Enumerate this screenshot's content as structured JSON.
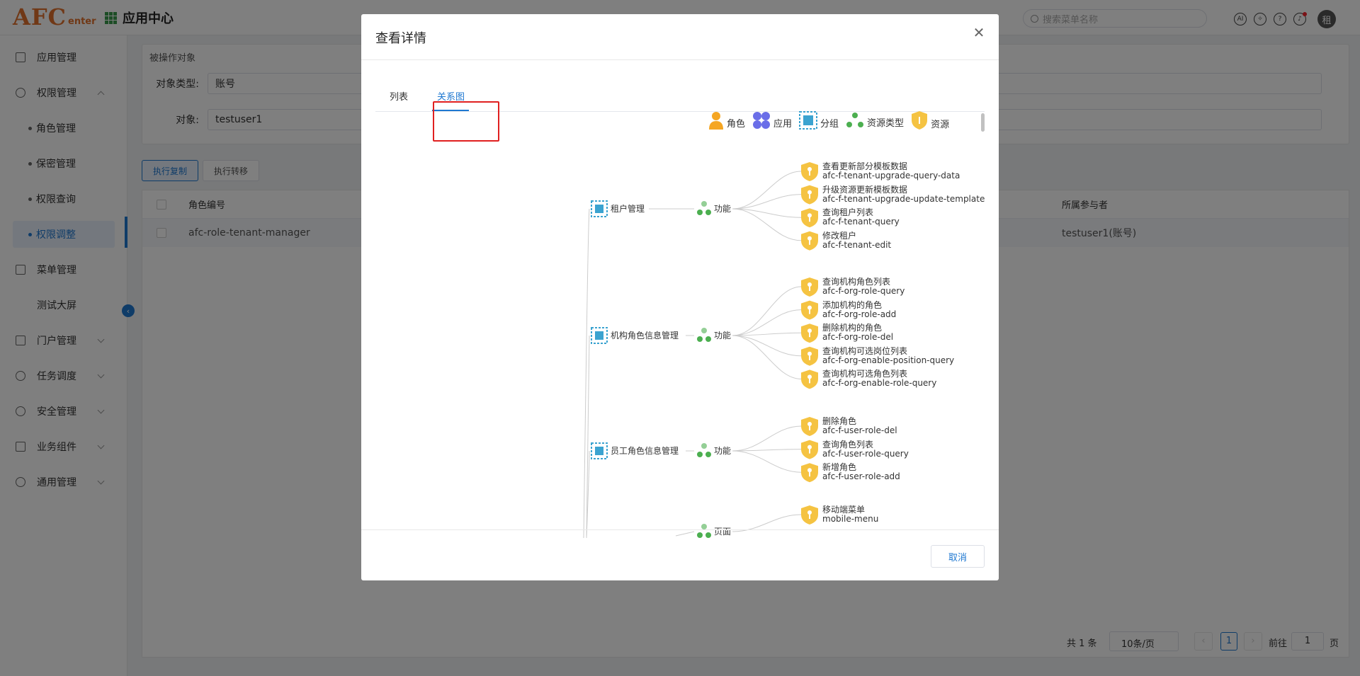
{
  "topbar": {
    "logo_main": "AFC",
    "logo_sub": "enter",
    "app_title": "应用中心",
    "search_placeholder": "搜索菜单名称",
    "ai_label": "AI",
    "avatar_text": "租"
  },
  "sidebar": {
    "items": [
      {
        "label": "应用管理"
      },
      {
        "label": "权限管理"
      },
      {
        "label": "角色管理"
      },
      {
        "label": "保密管理"
      },
      {
        "label": "权限查询"
      },
      {
        "label": "权限调整"
      },
      {
        "label": "菜单管理"
      },
      {
        "label": "测试大屏"
      },
      {
        "label": "门户管理"
      },
      {
        "label": "任务调度"
      },
      {
        "label": "安全管理"
      },
      {
        "label": "业务组件"
      },
      {
        "label": "通用管理"
      }
    ]
  },
  "panel": {
    "title": "被操作对象",
    "type_label": "对象类型:",
    "type_value": "账号",
    "object_label": "对象:",
    "object_value": "testuser1"
  },
  "buttons": {
    "copy": "执行复制",
    "transfer": "执行转移"
  },
  "table": {
    "col_role_code": "角色编号",
    "col_participant": "所属参与者",
    "row_role_code": "afc-role-tenant-manager",
    "row_participant": "testuser1(账号)"
  },
  "pager": {
    "total": "共 1 条",
    "page_size": "10条/页",
    "current": "1",
    "goto_label": "前往",
    "goto_value": "1",
    "page_unit": "页"
  },
  "dialog": {
    "title": "查看详情",
    "tab_list": "列表",
    "tab_graph": "关系图",
    "cancel": "取消",
    "legend": {
      "role": "角色",
      "app": "应用",
      "group": "分组",
      "resource_type": "资源类型",
      "resource": "资源"
    },
    "groups": [
      {
        "name": "租户管理",
        "type": "功能",
        "resources": [
          {
            "name": "查看更新部分模板数据",
            "code": "afc-f-tenant-upgrade-query-data"
          },
          {
            "name": "升级资源更新模板数据",
            "code": "afc-f-tenant-upgrade-update-template"
          },
          {
            "name": "查询租户列表",
            "code": "afc-f-tenant-query"
          },
          {
            "name": "修改租户",
            "code": "afc-f-tenant-edit"
          }
        ]
      },
      {
        "name": "机构角色信息管理",
        "type": "功能",
        "resources": [
          {
            "name": "查询机构角色列表",
            "code": "afc-f-org-role-query"
          },
          {
            "name": "添加机构的角色",
            "code": "afc-f-org-role-add"
          },
          {
            "name": "删除机构的角色",
            "code": "afc-f-org-role-del"
          },
          {
            "name": "查询机构可选岗位列表",
            "code": "afc-f-org-enable-position-query"
          },
          {
            "name": "查询机构可选角色列表",
            "code": "afc-f-org-enable-role-query"
          }
        ]
      },
      {
        "name": "员工角色信息管理",
        "type": "功能",
        "resources": [
          {
            "name": "删除角色",
            "code": "afc-f-user-role-del"
          },
          {
            "name": "查询角色列表",
            "code": "afc-f-user-role-query"
          },
          {
            "name": "新增角色",
            "code": "afc-f-user-role-add"
          }
        ]
      },
      {
        "name": "",
        "type": "页面",
        "resources": [
          {
            "name": "移动端菜单",
            "code": "mobile-menu"
          }
        ]
      }
    ]
  },
  "colors": {
    "accent": "#1f78d1",
    "group_node": "#3ba3d0",
    "resource_shield": "#f5c342",
    "resource_type": "#4caf50",
    "role": "#f5a623",
    "app": "#6a6ee8"
  }
}
